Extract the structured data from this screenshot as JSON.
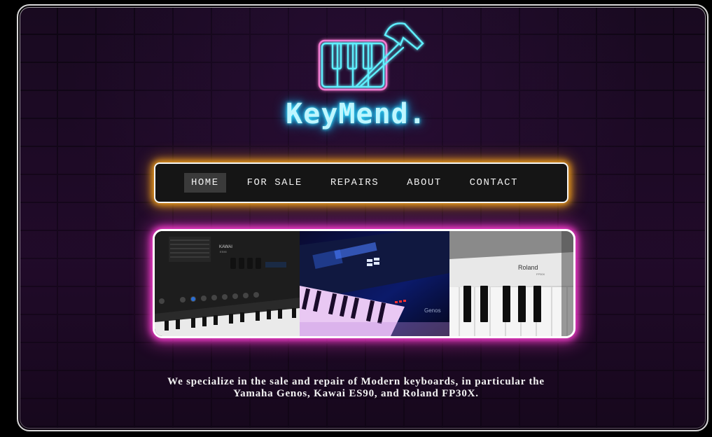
{
  "brand": {
    "name": "KeyMend."
  },
  "nav": {
    "items": [
      {
        "label": "HOME",
        "active": true
      },
      {
        "label": "FOR SALE",
        "active": false
      },
      {
        "label": "REPAIRS",
        "active": false
      },
      {
        "label": "ABOUT",
        "active": false
      },
      {
        "label": "CONTACT",
        "active": false
      }
    ]
  },
  "gallery": {
    "photos": [
      {
        "subject": "kawai-es90-keyboard",
        "brand_mark": "KAWAI",
        "model_mark": "ES90"
      },
      {
        "subject": "yamaha-genos-keyboard",
        "brand_mark": "Genos"
      },
      {
        "subject": "roland-fp30x-keyboard",
        "brand_mark": "Roland",
        "model_mark": "FP30X"
      }
    ]
  },
  "caption": {
    "line1": "We specialize in the sale and repair of Modern keyboards, in particular the",
    "line2": "Yamaha Genos, Kawai ES90, and Roland FP30X."
  },
  "colors": {
    "neon_cyan": "#3fe6ff",
    "neon_pink": "#ff5fc8",
    "nav_glow": "#f6a21a",
    "gallery_glow": "#ff3fd4",
    "brick_background": "#1a0b22"
  },
  "icons": {
    "logo": "piano-hammer-icon"
  }
}
